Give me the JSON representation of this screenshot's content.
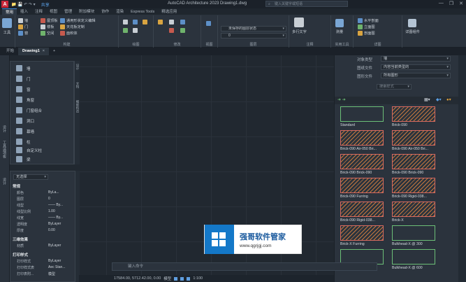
{
  "app": {
    "logo_text": "A",
    "quick_access": "📁 💾 ↶ ↷ ▾",
    "share_label": "共享",
    "title": "AutoCAD Architecture 2023   Drawing1.dwg",
    "search_placeholder": "键入关键字或短语",
    "window_controls": [
      "—",
      "❐",
      "✕"
    ]
  },
  "ribbon_tabs": [
    "常用",
    "插入",
    "注释",
    "视图",
    "管理",
    "附加模块",
    "协作",
    "渲染",
    "Express Tools",
    "精选应用"
  ],
  "ribbon": {
    "tools_label": "工具",
    "build_buttons": [
      "墙",
      "门",
      "窗",
      "屋顶板",
      "楼板",
      "空间",
      "墙段",
      "楼梯"
    ],
    "build_more": [
      "通用形状定义编辑",
      "天花板定制",
      "面积体"
    ],
    "build_panel": "构建",
    "draw_panel": "绘图",
    "modify_panel": "修改",
    "view_panel": "视图",
    "layer_dd1": "未保存的图层状态",
    "layer_dd2": "0",
    "layer_panel": "图层",
    "annotate_big": "多行文字",
    "annotate_panel": "注释",
    "utility_panel": "实用工具",
    "measure_label": "测量",
    "right_labels": [
      "水平剖面",
      "立面图",
      "剖面图",
      "详图"
    ],
    "right_panel": "详图",
    "more_label": "详图组件"
  },
  "file_tabs": {
    "start": "开始",
    "doc": "Drawing1",
    "close": "×",
    "add": "+"
  },
  "left_strip": [
    "设计",
    "工具选项板",
    "设计"
  ],
  "tool_palette": {
    "items": [
      "墙",
      "门",
      "窗",
      "角窗",
      "门窗组合",
      "洞口",
      "幕墙",
      "柱",
      "自定义柱",
      "梁"
    ],
    "side_tabs": [
      "设计",
      "文档",
      "细部构造"
    ]
  },
  "properties": {
    "selection": "无选择",
    "sections": [
      "常规",
      "三维效果",
      "打印样式"
    ],
    "rows": [
      {
        "k": "颜色",
        "v": "ByLa..."
      },
      {
        "k": "图层",
        "v": "0"
      },
      {
        "k": "线型",
        "v": "—— By..."
      },
      {
        "k": "线型比例",
        "v": "1.00"
      },
      {
        "k": "线宽",
        "v": "—— By..."
      },
      {
        "k": "透明度",
        "v": "ByLayer"
      },
      {
        "k": "厚度",
        "v": "0.00"
      },
      {
        "k": "材质",
        "v": "ByLayer"
      },
      {
        "k": "打印样式",
        "v": "ByLayer"
      },
      {
        "k": "打印样式表",
        "v": "Aec Stan..."
      },
      {
        "k": "打印表附...",
        "v": "模型"
      }
    ]
  },
  "style_manager": {
    "object_type_label": "对象类型",
    "object_type": "墙",
    "display_label": "图纸文件",
    "display_value": "内容当前类型的",
    "file_label": "图形文件",
    "file_value": "所有图形",
    "search_placeholder": "搜索样式",
    "tiles": [
      "Standard",
      "Brick-090",
      "Brick-090 Air-050 Bri...",
      "Brick-090 Air-050 Bri...",
      "Brick-090 Brick-090",
      "Brick-090 Brick-090",
      "Brick-090 Furring",
      "Brick-090 Rigid-038...",
      "Brick-090 Rigid-038...",
      "Brick-X",
      "Brick-X Furring",
      "Bulkhead-X @ 300",
      "Bulkhead-X @ 450",
      "Bulkhead-X @ 600"
    ]
  },
  "command": {
    "placeholder": "键入命令"
  },
  "status": {
    "coords": "17584.00, 5712.42.00, 0.00",
    "model": "模型",
    "scale": "1:100"
  },
  "watermark": {
    "title": "强哥软件管家",
    "url": "www.qgrjgj.com"
  }
}
